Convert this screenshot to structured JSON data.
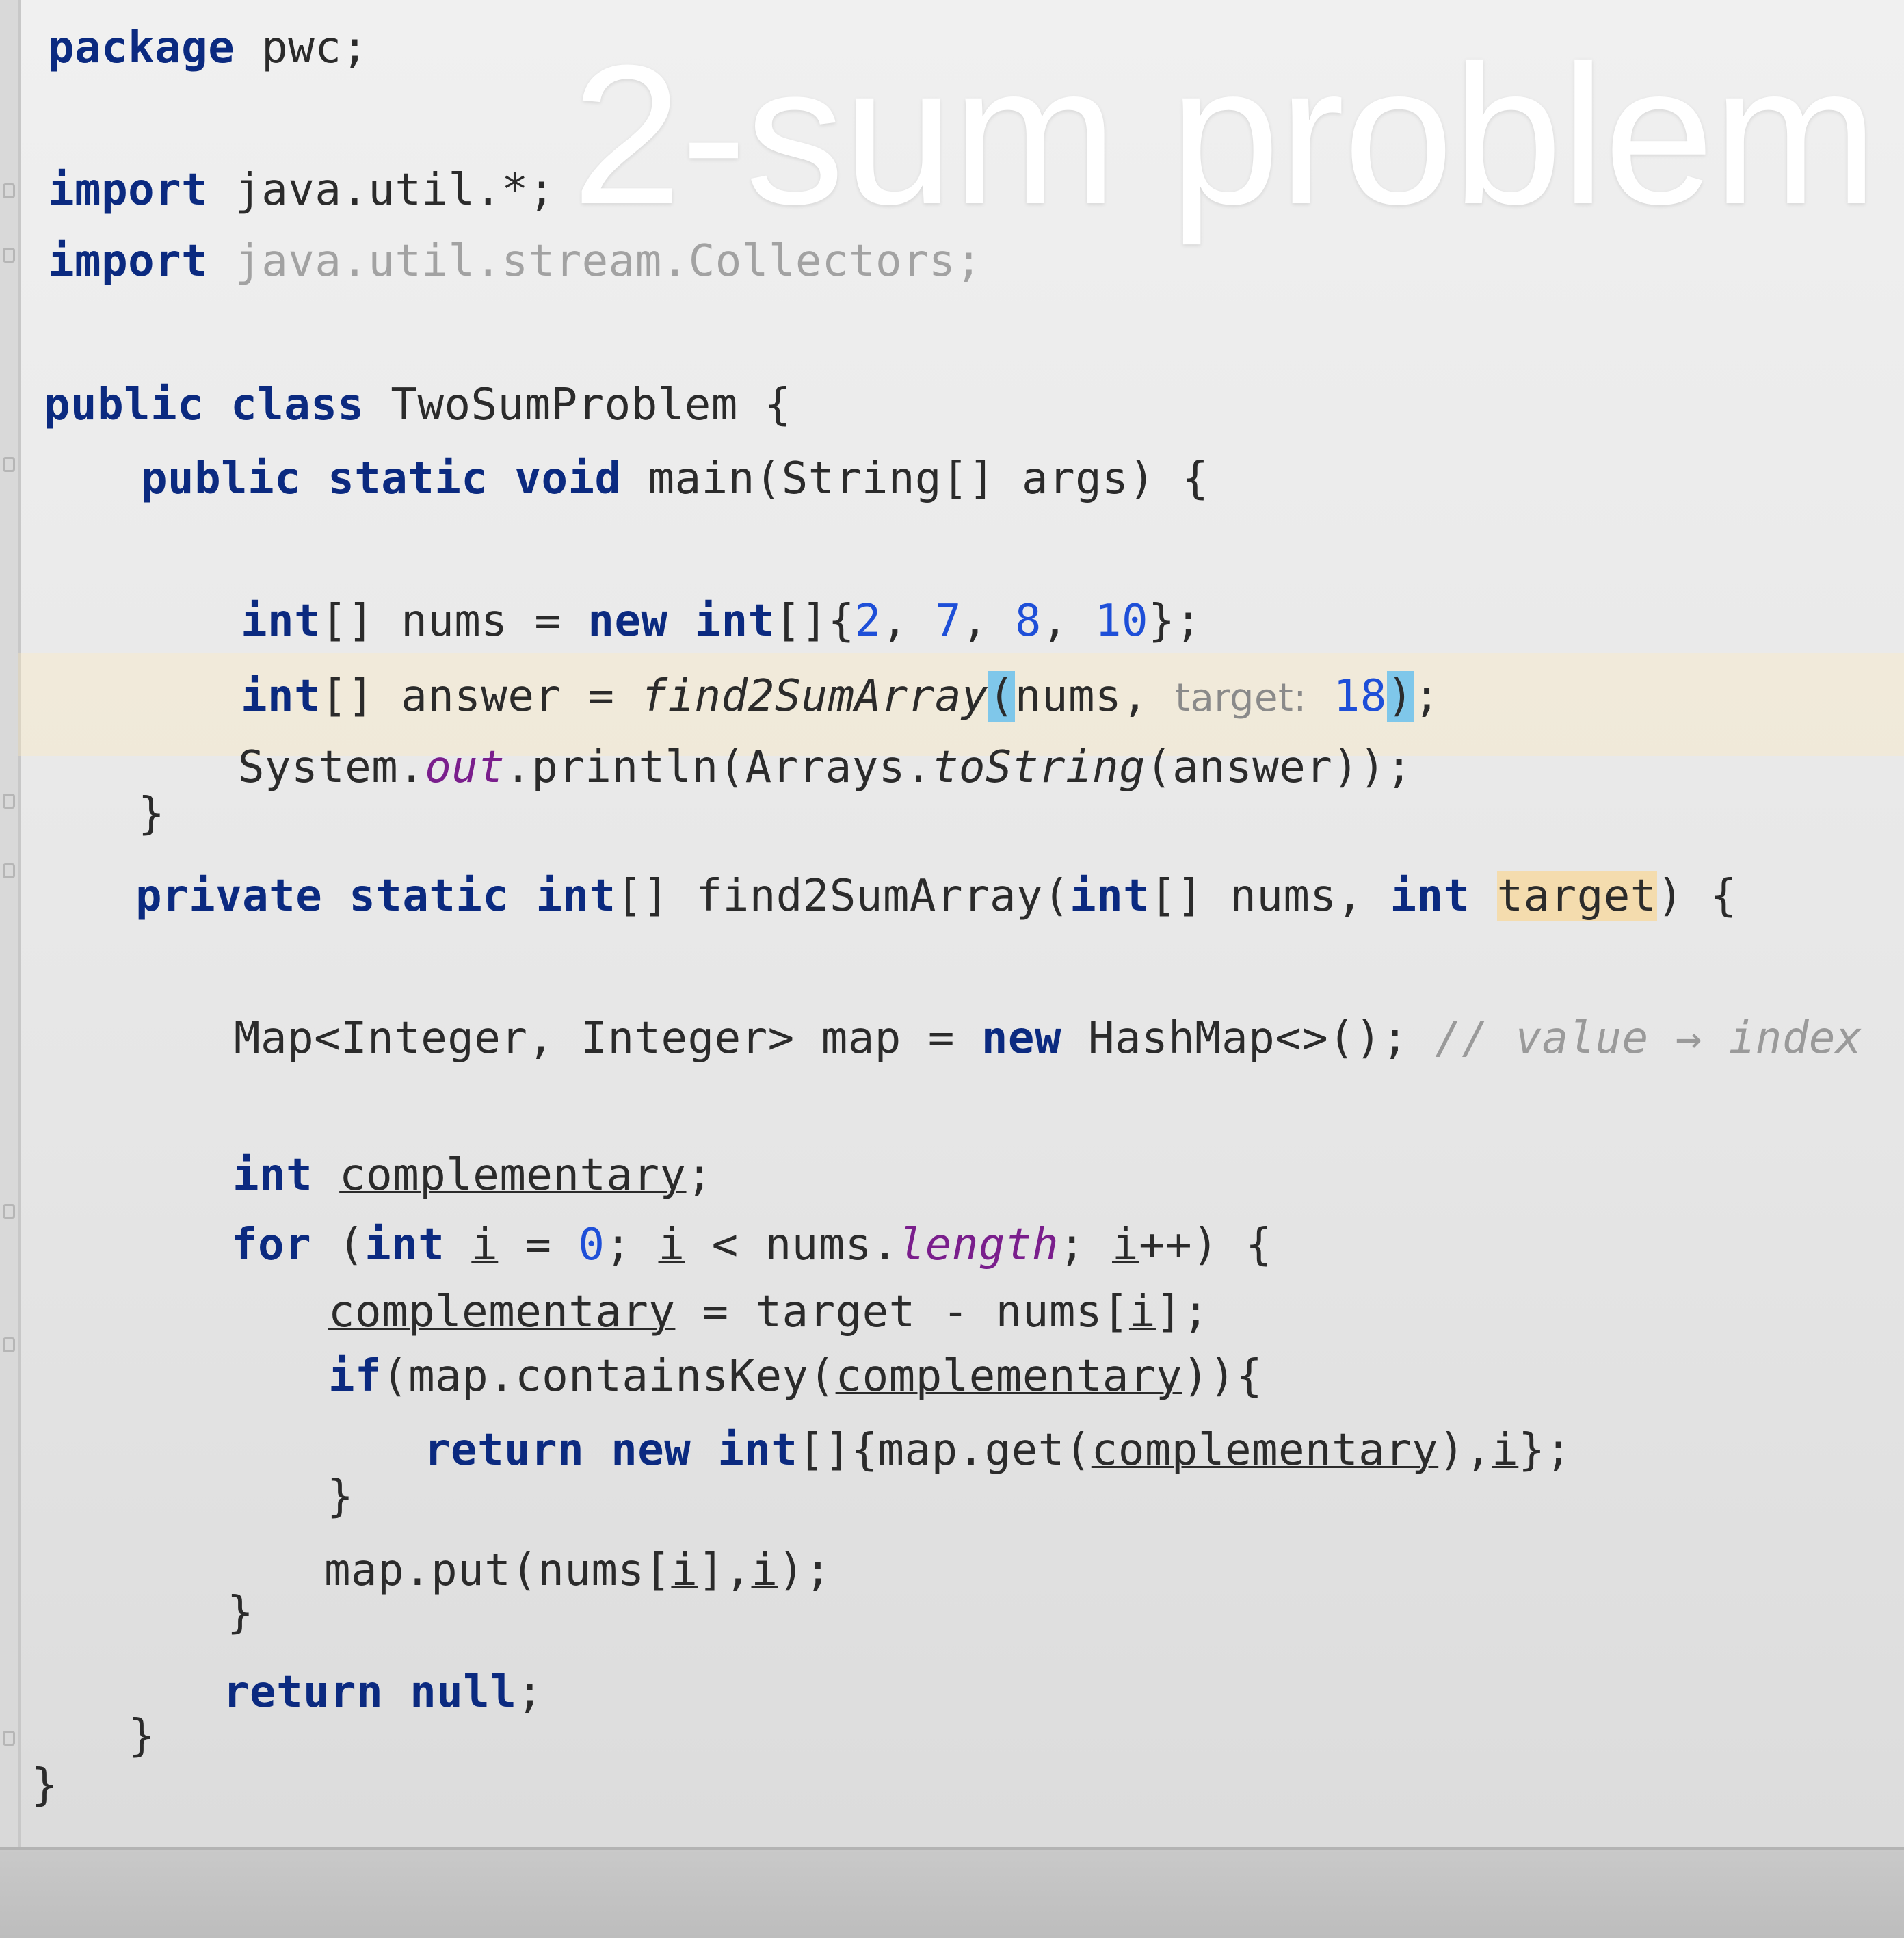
{
  "overlay_title": "2-sum problem",
  "code": {
    "package_kw": "package",
    "package_name": " pwc;",
    "import1_kw": "import",
    "import1_rest": " java.util.*;",
    "import2_kw": "import",
    "import2_rest": " java.util.stream.Collectors;",
    "class_mods": "public class",
    "class_rest": " TwoSumProblem {",
    "main_mods": "public static void",
    "main_rest": " main(String[] args) {",
    "nums_type": "int",
    "nums_a": "[] nums = ",
    "nums_new": "new",
    "nums_sp": " ",
    "nums_int": "int",
    "nums_b": "[]{",
    "nums_v1": "2",
    "nums_c1": ", ",
    "nums_v2": "7",
    "nums_c2": ", ",
    "nums_v3": "8",
    "nums_c3": ", ",
    "nums_v4": "10",
    "nums_end": "};",
    "ans_type": "int",
    "ans_a": "[] answer = ",
    "ans_fn": "find2SumArray",
    "ans_open": "(",
    "ans_arg": "nums, ",
    "ans_hint": "target:",
    "ans_num": " 18",
    "ans_close": ")",
    "ans_end": ";",
    "print_a": "System.",
    "print_out": "out",
    "print_b": ".println(Arrays.",
    "print_fn": "toString",
    "print_c": "(answer));",
    "close_main": "}",
    "f_mods": "private static",
    "f_sp": " ",
    "f_int": "int",
    "f_a": "[] find2SumArray(",
    "f_int2": "int",
    "f_b": "[] nums, ",
    "f_int3": "int",
    "f_sp2": " ",
    "f_target": "target",
    "f_end": ") {",
    "map_a": "Map<Integer, Integer> map = ",
    "map_new": "new",
    "map_b": " HashMap<>(); ",
    "map_cmt": "// value → index",
    "comp_int": "int",
    "comp_sp": " ",
    "comp_var": "complementary",
    "comp_end": ";",
    "for_kw": "for",
    "for_a": " (",
    "for_int": "int",
    "for_sp": " ",
    "for_i1": "i",
    "for_b": " = ",
    "for_zero": "0",
    "for_c": "; ",
    "for_i2": "i",
    "for_d": " < nums.",
    "for_len": "length",
    "for_e": "; ",
    "for_i3": "i",
    "for_f": "++) {",
    "assign_var": "complementary",
    "assign_a": " = target - nums[",
    "assign_i": "i",
    "assign_end": "];",
    "if_kw": "if",
    "if_a": "(map.containsKey(",
    "if_var": "complementary",
    "if_end": ")){",
    "ret_kw": "return",
    "ret_sp": " ",
    "ret_new": "new",
    "ret_sp2": " ",
    "ret_int": "int",
    "ret_a": "[]{map.get(",
    "ret_var": "complementary",
    "ret_b": "),",
    "ret_i": "i",
    "ret_end": "};",
    "close_if": "}",
    "put_a": "map.put(nums[",
    "put_i1": "i",
    "put_b": "],",
    "put_i2": "i",
    "put_end": ");",
    "close_for": "}",
    "retnull_kw": "return",
    "retnull_sp": " ",
    "retnull_null": "null",
    "retnull_end": ";",
    "close_method": "}",
    "close_class": "}"
  }
}
